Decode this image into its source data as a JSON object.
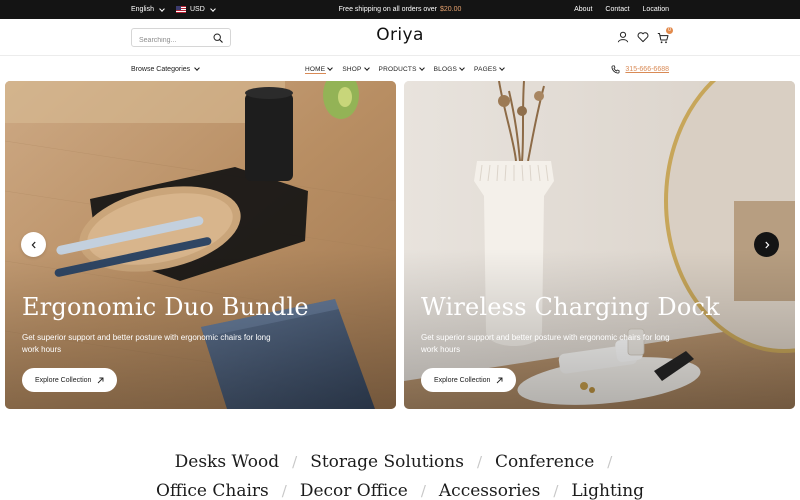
{
  "topbar": {
    "language": "English",
    "currency": "USD",
    "promo_text": "Free shipping on all orders over",
    "promo_amount": "$20.00",
    "links": [
      "About",
      "Contact",
      "Location"
    ]
  },
  "header": {
    "search_placeholder": "Searching...",
    "logo": "Oriya",
    "cart_count": "0"
  },
  "nav": {
    "browse_label": "Browse Categories",
    "menu": [
      "HOME",
      "SHOP",
      "PRODUCTS",
      "BLOGS",
      "PAGES"
    ],
    "active_item": "HOME",
    "phone": "315-666-6688"
  },
  "hero": {
    "slides": [
      {
        "title": "Ergonomic Duo Bundle",
        "description": "Get superior support and better posture with ergonomic chairs for long work hours",
        "cta": "Explore Collection"
      },
      {
        "title": "Wireless Charging Dock",
        "description": "Get superior support and better posture with ergonomic chairs for long work hours",
        "cta": "Explore Collection"
      }
    ]
  },
  "categories": {
    "row1": [
      "Desks Wood",
      "Storage Solutions",
      "Conference"
    ],
    "row2": [
      "Office Chairs",
      "Decor Office",
      "Accessories",
      "Lighting"
    ]
  },
  "colors": {
    "accent": "#d98a55",
    "topbar_bg": "#141414",
    "next_button_bg": "#141414"
  }
}
